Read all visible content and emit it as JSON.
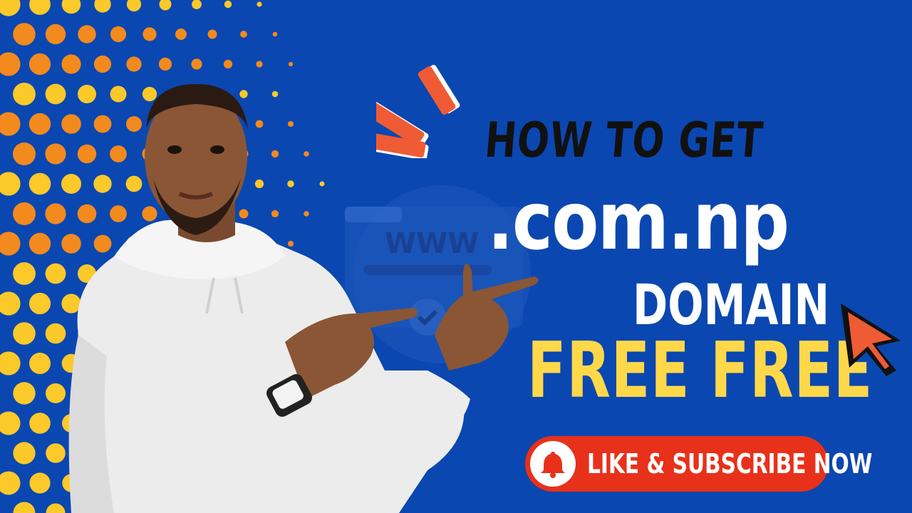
{
  "colors": {
    "background": "#0b47b0",
    "dots_dark": "#f28a1e",
    "dots_light": "#fbc92a",
    "headline_yellow": "#ffd84a",
    "button_red": "#e8311a",
    "accent_orange": "#ef5b35"
  },
  "headline": {
    "line1": "HOW TO GET",
    "line2": ".com.np",
    "line3": "DOMAIN",
    "line4": "FREE FREE"
  },
  "cta": {
    "label": "LIKE & SUBSCRIBE NOW",
    "icon": "bell-icon"
  },
  "decor": {
    "pointer_icon": "mouse-cursor-icon",
    "background_icon": "www-browser-icon",
    "www_text": "WWW"
  }
}
